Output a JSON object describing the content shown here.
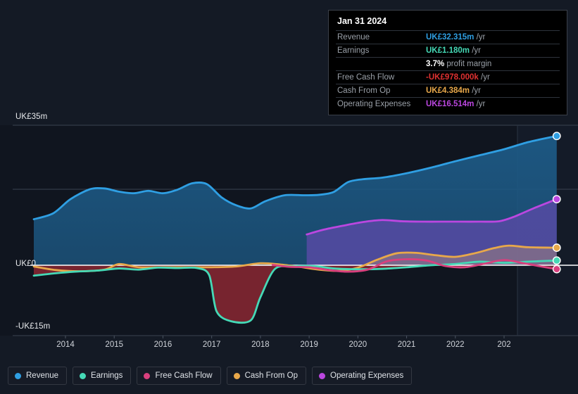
{
  "chart_data": {
    "type": "area",
    "title": "",
    "xlabel": "",
    "ylabel": "",
    "currency": "UK£",
    "ylim": [
      -15,
      35
    ],
    "grid": true,
    "legend_position": "bottom",
    "y_ticks": [
      {
        "value": 35,
        "label": "UK£35m"
      },
      {
        "value": 0,
        "label": "UK£0"
      },
      {
        "value": -15,
        "label": "-UK£15m"
      }
    ],
    "x_ticks": [
      "2014",
      "2015",
      "2016",
      "2017",
      "2018",
      "2019",
      "2020",
      "2021",
      "2022",
      "202"
    ],
    "x_range": [
      2013.35,
      2024.3
    ],
    "series": [
      {
        "name": "Revenue",
        "color": "#2f9fe3",
        "fill": "#1b4766",
        "x": [
          2013.35,
          2013.75,
          2014.1,
          2014.5,
          2014.8,
          2015.1,
          2015.4,
          2015.7,
          2016.0,
          2016.3,
          2016.6,
          2016.9,
          2017.2,
          2017.5,
          2017.8,
          2018.1,
          2018.5,
          2018.9,
          2019.2,
          2019.5,
          2019.8,
          2020.1,
          2020.5,
          2021.0,
          2021.5,
          2022.0,
          2022.5,
          2023.0,
          2023.5,
          2024.08
        ],
        "values": [
          11.5,
          13.0,
          16.5,
          19.0,
          19.2,
          18.4,
          18.0,
          18.6,
          18.0,
          18.9,
          20.5,
          20.3,
          17.0,
          15.0,
          14.2,
          16.0,
          17.5,
          17.5,
          17.6,
          18.3,
          20.8,
          21.5,
          21.9,
          23.0,
          24.4,
          26.0,
          27.5,
          29.0,
          30.8,
          32.315
        ]
      },
      {
        "name": "Earnings",
        "color": "#45d9b6",
        "fill": "#6b2230",
        "x": [
          2013.35,
          2013.8,
          2014.2,
          2014.7,
          2015.1,
          2015.5,
          2015.9,
          2016.3,
          2016.7,
          2016.95,
          2017.1,
          2017.4,
          2017.8,
          2018.0,
          2018.3,
          2018.7,
          2019.1,
          2019.5,
          2020.0,
          2020.5,
          2021.0,
          2021.5,
          2022.0,
          2022.5,
          2023.0,
          2023.5,
          2024.08
        ],
        "values": [
          -2.6,
          -2.0,
          -1.6,
          -1.3,
          -0.8,
          -1.1,
          -0.6,
          -0.7,
          -0.7,
          -2.5,
          -11.5,
          -14.0,
          -13.8,
          -8.0,
          -0.9,
          -0.3,
          -0.2,
          -0.8,
          -1.0,
          -0.9,
          -0.5,
          0.0,
          0.3,
          0.9,
          0.6,
          0.9,
          1.18
        ]
      },
      {
        "name": "Free Cash Flow",
        "color": "#d9407e",
        "fill": "#6b2230",
        "x": [
          2018.25,
          2018.6,
          2019.0,
          2019.4,
          2019.8,
          2020.2,
          2020.6,
          2021.0,
          2021.4,
          2021.8,
          2022.2,
          2022.6,
          2023.0,
          2023.4,
          2023.8,
          2024.08
        ],
        "values": [
          0.1,
          -0.4,
          -0.5,
          -1.2,
          -1.6,
          -1.1,
          1.0,
          1.5,
          1.2,
          -0.2,
          -0.5,
          0.4,
          1.3,
          0.5,
          -0.4,
          -0.978
        ]
      },
      {
        "name": "Cash From Op",
        "color": "#e8a84a",
        "fill": "#6b2230",
        "x": [
          2013.35,
          2013.8,
          2014.3,
          2014.8,
          2015.1,
          2015.5,
          2016.0,
          2016.5,
          2017.0,
          2017.5,
          2018.0,
          2018.4,
          2018.8,
          2019.2,
          2019.6,
          2020.0,
          2020.4,
          2020.8,
          2021.2,
          2021.6,
          2022.0,
          2022.4,
          2022.8,
          2023.1,
          2023.5,
          2024.08
        ],
        "values": [
          -0.3,
          -1.2,
          -1.5,
          -1.1,
          0.3,
          -0.5,
          -0.5,
          -0.5,
          -0.5,
          -0.3,
          0.5,
          0.2,
          -0.4,
          -1.1,
          -1.4,
          -0.6,
          1.4,
          3.0,
          3.1,
          2.5,
          2.1,
          3.0,
          4.3,
          4.9,
          4.5,
          4.384
        ]
      },
      {
        "name": "Operating Expenses",
        "color": "#bb47e0",
        "fill": "#3d3374",
        "x": [
          2018.95,
          2019.3,
          2019.7,
          2020.1,
          2020.5,
          2020.9,
          2021.3,
          2021.7,
          2022.1,
          2022.5,
          2022.9,
          2023.2,
          2023.6,
          2024.08
        ],
        "values": [
          7.7,
          8.9,
          9.9,
          10.8,
          11.3,
          11.0,
          10.9,
          10.9,
          10.9,
          10.9,
          11.0,
          12.1,
          14.2,
          16.514
        ]
      }
    ]
  },
  "tooltip": {
    "date": "Jan 31 2024",
    "rows": [
      {
        "key": "Revenue",
        "value": "UK£32.315m",
        "unit": "/yr",
        "color": "#2f9fe3"
      },
      {
        "key": "Earnings",
        "value": "UK£1.180m",
        "unit": "/yr",
        "color": "#45d9b6"
      },
      {
        "key": "",
        "value": "3.7%",
        "unit": "profit margin",
        "color": "#ffffff",
        "sub": true
      },
      {
        "key": "Free Cash Flow",
        "value": "-UK£978.000k",
        "unit": "/yr",
        "color": "#e03131"
      },
      {
        "key": "Cash From Op",
        "value": "UK£4.384m",
        "unit": "/yr",
        "color": "#e8a84a"
      },
      {
        "key": "Operating Expenses",
        "value": "UK£16.514m",
        "unit": "/yr",
        "color": "#bb47e0"
      }
    ]
  },
  "legend": {
    "items": [
      {
        "label": "Revenue",
        "color": "#2f9fe3"
      },
      {
        "label": "Earnings",
        "color": "#45d9b6"
      },
      {
        "label": "Free Cash Flow",
        "color": "#d9407e"
      },
      {
        "label": "Cash From Op",
        "color": "#e8a84a"
      },
      {
        "label": "Operating Expenses",
        "color": "#bb47e0"
      }
    ]
  }
}
